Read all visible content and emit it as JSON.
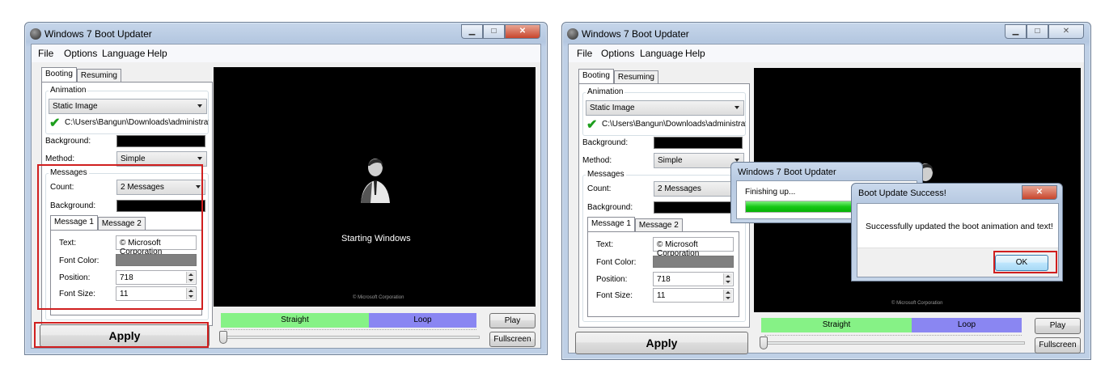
{
  "window": {
    "title": "Windows 7 Boot Updater",
    "menu": [
      "File",
      "Options",
      "Language",
      "Help"
    ]
  },
  "main_tabs": [
    "Booting",
    "Resuming"
  ],
  "animation": {
    "group_label": "Animation",
    "type_value": "Static Image",
    "file_path": "C:\\Users\\Bangun\\Downloads\\administrator.png"
  },
  "background_label": "Background:",
  "method": {
    "label": "Method:",
    "value": "Simple"
  },
  "messages": {
    "group_label": "Messages",
    "count_label": "Count:",
    "count_value": "2 Messages",
    "background_label": "Background:",
    "tabs": [
      "Message 1",
      "Message 2"
    ],
    "text_label": "Text:",
    "text_value": "© Microsoft Corporation",
    "font_color_label": "Font Color:",
    "position_label": "Position:",
    "position_value": "718",
    "font_size_label": "Font Size:",
    "font_size_value": "11"
  },
  "preview": {
    "starting_text": "Starting Windows",
    "copyright": "© Microsoft Corporation"
  },
  "playback": {
    "straight_label": "Straight",
    "loop_label": "Loop",
    "play_label": "Play",
    "fullscreen_label": "Fullscreen"
  },
  "apply_label": "Apply",
  "progress_dialog": {
    "title": "Windows 7 Boot Updater",
    "status": "Finishing up...",
    "progress_fraction": 1.0
  },
  "success_dialog": {
    "title": "Boot Update Success!",
    "message": "Successfully updated the boot animation and text!",
    "ok_label": "OK"
  },
  "colors": {
    "background_swatch": "#000000",
    "font_color_swatch": "#808080",
    "straight_bar": "#86f286",
    "loop_bar": "#8a86f2",
    "highlight": "#d01f1f"
  }
}
